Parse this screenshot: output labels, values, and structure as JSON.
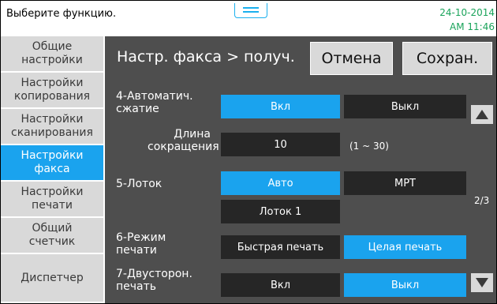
{
  "top": {
    "title": "Выберите функцию.",
    "date": "24-10-2014",
    "time": "AM 11:46"
  },
  "sidebar": {
    "items": [
      {
        "label": "Общие\nнастройки",
        "active": false
      },
      {
        "label": "Настройки\nкопирования",
        "active": false
      },
      {
        "label": "Настройки\nсканирования",
        "active": false
      },
      {
        "label": "Настройки\nфакса",
        "active": true
      },
      {
        "label": "Настройки\nпечати",
        "active": false
      },
      {
        "label": "Общий\nсчетчик",
        "active": false
      },
      {
        "label": "Диспетчер",
        "active": false
      }
    ]
  },
  "header": {
    "breadcrumb": "Настр. факса > получ.",
    "cancel_label": "Отмена",
    "save_label": "Сохран."
  },
  "settings": {
    "auto_compress": {
      "label": "4-Автоматич.\nсжатие",
      "on": "Вкл",
      "off": "Выкл",
      "selected": "on"
    },
    "reduction_length": {
      "label": "Длина\nсокращения",
      "value": "10",
      "range": "(1 ~ 30)"
    },
    "tray": {
      "label": "5-Лоток",
      "auto": "Авто",
      "mpt": "MPT",
      "tray1": "Лоток 1",
      "selected": "auto"
    },
    "print_mode": {
      "label": "6-Режим\nпечати",
      "fast": "Быстрая печать",
      "whole": "Целая печать",
      "selected": "whole"
    },
    "duplex": {
      "label": "7-Двусторон.\nпечать",
      "on": "Вкл",
      "off": "Выкл",
      "selected": "off"
    }
  },
  "pager": {
    "page": "2/3",
    "up_icon": "triangle-up",
    "down_icon": "triangle-down"
  },
  "colors": {
    "accent": "#1aa3ee",
    "background": "#4e4e4e",
    "option_dark": "#262626",
    "button_light": "#d9d9d9",
    "time_text": "#1aa35a"
  }
}
